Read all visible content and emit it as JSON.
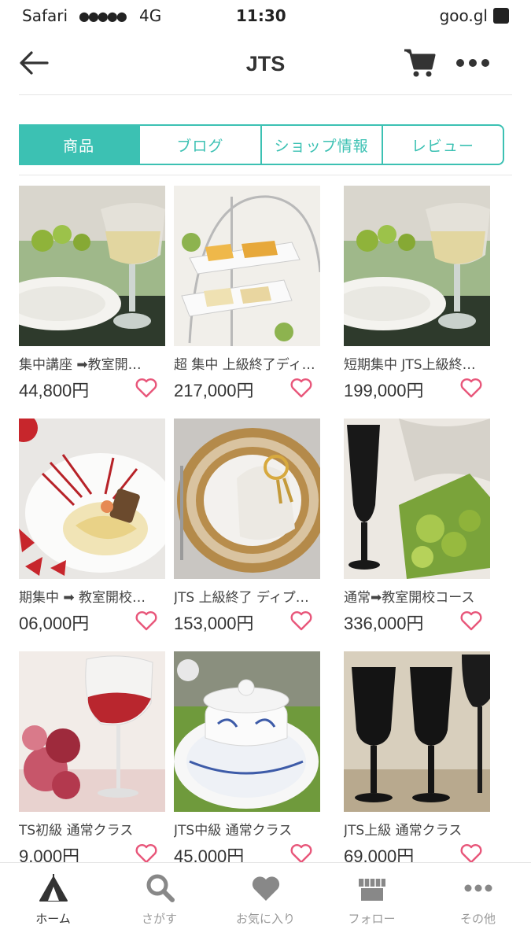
{
  "status_bar": {
    "carrier": "Safari",
    "signal": "●●●●●",
    "network": "4G",
    "time": "11:30",
    "url": "goo.gl"
  },
  "header": {
    "title": "JTS",
    "back_icon": "arrow-left-icon",
    "cart_icon": "cart-icon",
    "more_icon": "more-horizontal-icon"
  },
  "tabs": [
    {
      "label": "商品",
      "active": true
    },
    {
      "label": "ブログ",
      "active": false
    },
    {
      "label": "ショップ情報",
      "active": false
    },
    {
      "label": "レビュー",
      "active": false
    }
  ],
  "products": [
    {
      "name": "集中講座 ➡教室開…",
      "price": "44,800円"
    },
    {
      "name": "超 集中 上級終了ディ…",
      "price": "217,000円"
    },
    {
      "name": "短期集中 JTS上級終…",
      "price": "199,000円"
    },
    {
      "name": "期集中 ➡ 教室開校…",
      "price": "06,000円"
    },
    {
      "name": "JTS 上級終了 ディプ…",
      "price": "153,000円"
    },
    {
      "name": "通常➡教室開校コース",
      "price": "336,000円"
    },
    {
      "name": "TS初級 通常クラス",
      "price": "9,000円"
    },
    {
      "name": "JTS中級 通常クラス",
      "price": "45,000円"
    },
    {
      "name": "JTS上級 通常クラス",
      "price": "69,000円"
    }
  ],
  "bottom_nav": [
    {
      "label": "ホーム",
      "icon": "tent-icon",
      "active": true
    },
    {
      "label": "さがす",
      "icon": "search-icon",
      "active": false
    },
    {
      "label": "お気に入り",
      "icon": "heart-icon",
      "active": false
    },
    {
      "label": "フォロー",
      "icon": "shop-icon",
      "active": false
    },
    {
      "label": "その他",
      "icon": "more-horizontal-icon",
      "active": false
    }
  ],
  "colors": {
    "accent": "#3cc1b3",
    "favorite": "#e8567a",
    "nav_icon": "#888888"
  }
}
